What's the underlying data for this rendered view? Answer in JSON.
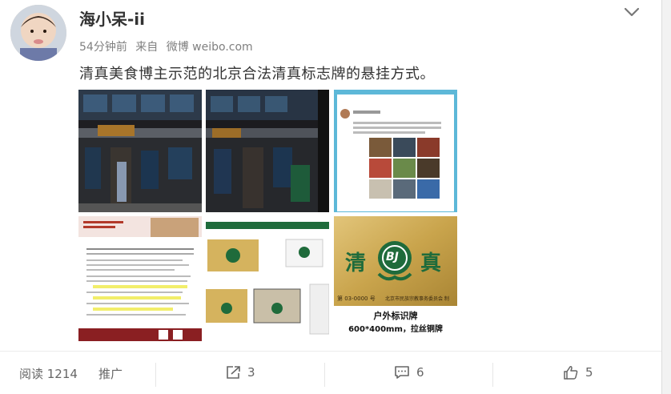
{
  "post": {
    "username": "海小呆-ii",
    "time": "54分钟前",
    "source_prefix": "来自",
    "source_name": "微博 weibo.com",
    "text": "清真美食博主示范的北京合法清真标志牌的悬挂方式。"
  },
  "photos": {
    "photo6": {
      "halal_left": "清",
      "halal_right": "真",
      "logo_letters": "BJ",
      "number": "第 03-0000 号",
      "issuer": "北京市民族宗教事务委员会 制",
      "caption_line1": "户外标识牌",
      "caption_line2": "600*400mm，拉丝铜牌"
    }
  },
  "footer": {
    "read_label": "阅读 1214",
    "promote_label": "推广",
    "repost_count": "3",
    "comment_count": "6",
    "like_count": "5"
  },
  "icons": {
    "chevron": "chevron-down-icon",
    "repost": "repost-icon",
    "comment": "comment-icon",
    "like": "thumbs-up-icon"
  },
  "colors": {
    "text_main": "#333333",
    "text_meta": "#808080",
    "halal_green": "#1f6b3b",
    "gold": "#c9a44c"
  }
}
